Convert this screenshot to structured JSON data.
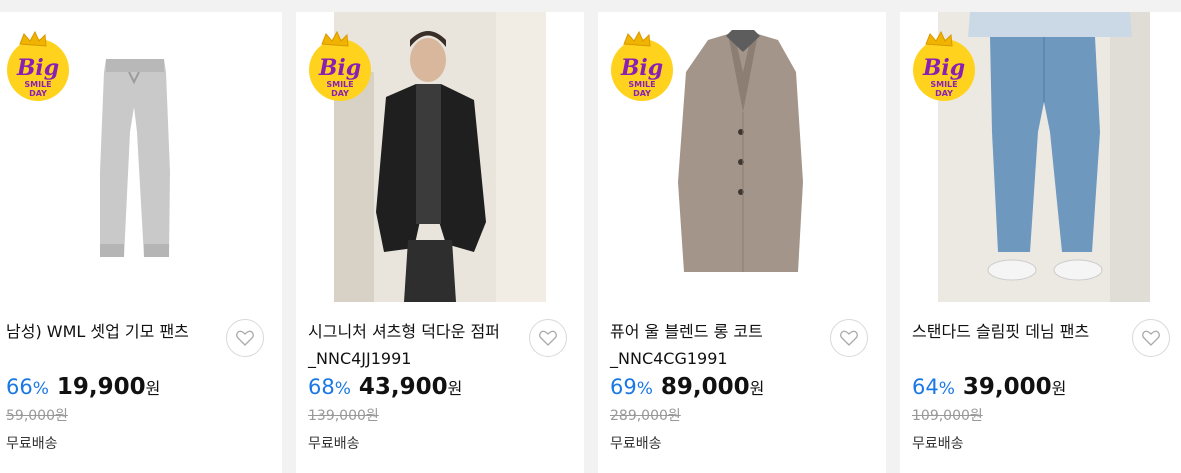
{
  "badge": {
    "big": "Big",
    "smile": "SMILE",
    "day": "DAY"
  },
  "products": [
    {
      "title": "남성) WML 셋업 기모 팬츠",
      "rate": "66",
      "pct": "%",
      "price": "19,900",
      "won": "원",
      "orig": "59,000원",
      "shipping": "무료배송"
    },
    {
      "title": "시그니처 셔츠형 덕다운 점퍼 _NNC4JJ1991",
      "rate": "68",
      "pct": "%",
      "price": "43,900",
      "won": "원",
      "orig": "139,000원",
      "shipping": "무료배송"
    },
    {
      "title": "퓨어 울 블렌드 롱 코트 _NNC4CG1991",
      "rate": "69",
      "pct": "%",
      "price": "89,000",
      "won": "원",
      "orig": "289,000원",
      "shipping": "무료배송"
    },
    {
      "title": "스탠다드 슬림핏 데님 팬츠",
      "rate": "64",
      "pct": "%",
      "price": "39,000",
      "won": "원",
      "orig": "109,000원",
      "shipping": "무료배송"
    }
  ],
  "colors": {
    "discount": "#1a78e6",
    "badge_yellow": "#ffd21e",
    "badge_purple": "#8a1fb4"
  }
}
